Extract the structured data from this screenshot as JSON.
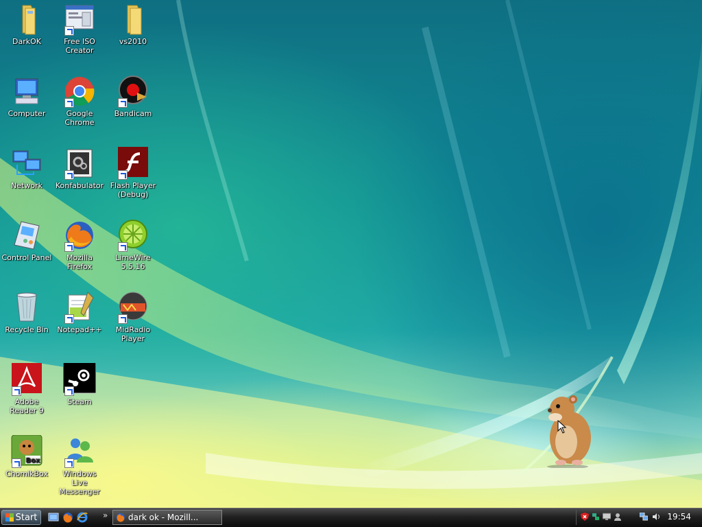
{
  "desktop": {
    "icons": [
      {
        "label": "DarkOK",
        "icon": "folder-icon"
      },
      {
        "label": "Free ISO Creator",
        "icon": "iso-creator-icon"
      },
      {
        "label": "vs2010",
        "icon": "folder-icon"
      },
      {
        "label": "Computer",
        "icon": "computer-icon"
      },
      {
        "label": "Google Chrome",
        "icon": "chrome-icon"
      },
      {
        "label": "Bandicam",
        "icon": "bandicam-icon"
      },
      {
        "label": "Network",
        "icon": "network-icon"
      },
      {
        "label": "Konfabulator",
        "icon": "konfabulator-icon"
      },
      {
        "label": "Flash Player (Debug)",
        "icon": "flash-icon"
      },
      {
        "label": "Control Panel",
        "icon": "control-panel-icon"
      },
      {
        "label": "Mozilla Firefox",
        "icon": "firefox-icon"
      },
      {
        "label": "LimeWire 5.5.16",
        "icon": "limewire-icon"
      },
      {
        "label": "Recycle Bin",
        "icon": "recycle-bin-icon"
      },
      {
        "label": "Notepad++",
        "icon": "notepadpp-icon"
      },
      {
        "label": "MidRadio Player",
        "icon": "midradio-icon"
      },
      {
        "label": "Adobe Reader 9",
        "icon": "adobe-reader-icon"
      },
      {
        "label": "Steam",
        "icon": "steam-icon"
      },
      {
        "label": "ChomikBox",
        "icon": "chomikbox-icon"
      },
      {
        "label": "Windows Live Messenger",
        "icon": "messenger-icon"
      }
    ]
  },
  "taskbar": {
    "start_label": "Start",
    "quicklaunch": [
      "show-desktop-icon",
      "firefox-icon",
      "ie-icon"
    ],
    "overflow_label": "»",
    "tasks": [
      {
        "label": "dark ok - Mozill...",
        "icon": "firefox-icon"
      }
    ],
    "tray": [
      "security-alert-icon",
      "network-tray-icon",
      "display-icon",
      "user-icon",
      "connection-icon",
      "volume-icon"
    ],
    "clock": "19:54"
  },
  "colors": {
    "taskbar": "#1a1a1a",
    "wallpaper_teal": "#118e96",
    "wallpaper_yellow": "#eaf38c"
  }
}
